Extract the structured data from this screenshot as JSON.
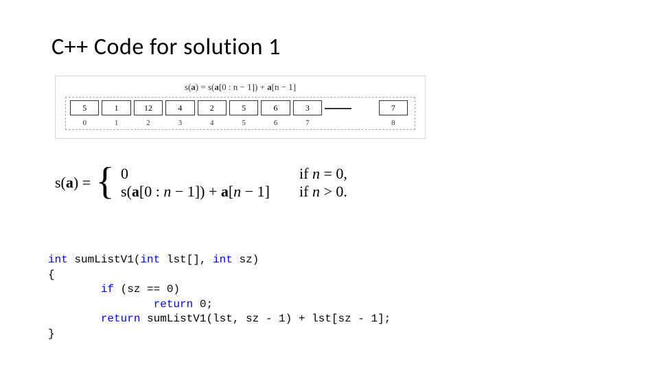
{
  "title": "C++ Code for solution 1",
  "diagram": {
    "formula_small_html": "s(<b>a</b>) = s(<b>a</b>[0 : n − 1]) + <b>a</b>[n − 1]",
    "cells": [
      "5",
      "1",
      "12",
      "4",
      "2",
      "5",
      "6",
      "3",
      "7"
    ],
    "indices": [
      "0",
      "1",
      "2",
      "3",
      "4",
      "5",
      "6",
      "7",
      "8"
    ]
  },
  "formula_big": {
    "lhs_html": "s(<b>a</b>) = ",
    "case1_val": "0",
    "case1_cond_html": "if <i>n</i> = 0,",
    "case2_val_html": "s(<b>a</b>[0 : <i>n</i> − 1]) + <b>a</b>[<i>n</i> − 1]",
    "case2_cond_html": "if <i>n</i> > 0."
  },
  "code": {
    "l1_a": "int",
    "l1_b": " sumListV1(",
    "l1_c": "int",
    "l1_d": " lst[], ",
    "l1_e": "int",
    "l1_f": " sz)",
    "l2": "{",
    "l3_a": "        if",
    "l3_b": " (sz == 0)",
    "l4_a": "                return",
    "l4_b": " 0;",
    "l5_a": "        return",
    "l5_b": " sumListV1(lst, sz - 1) + lst[sz - 1];",
    "l6": "}"
  }
}
